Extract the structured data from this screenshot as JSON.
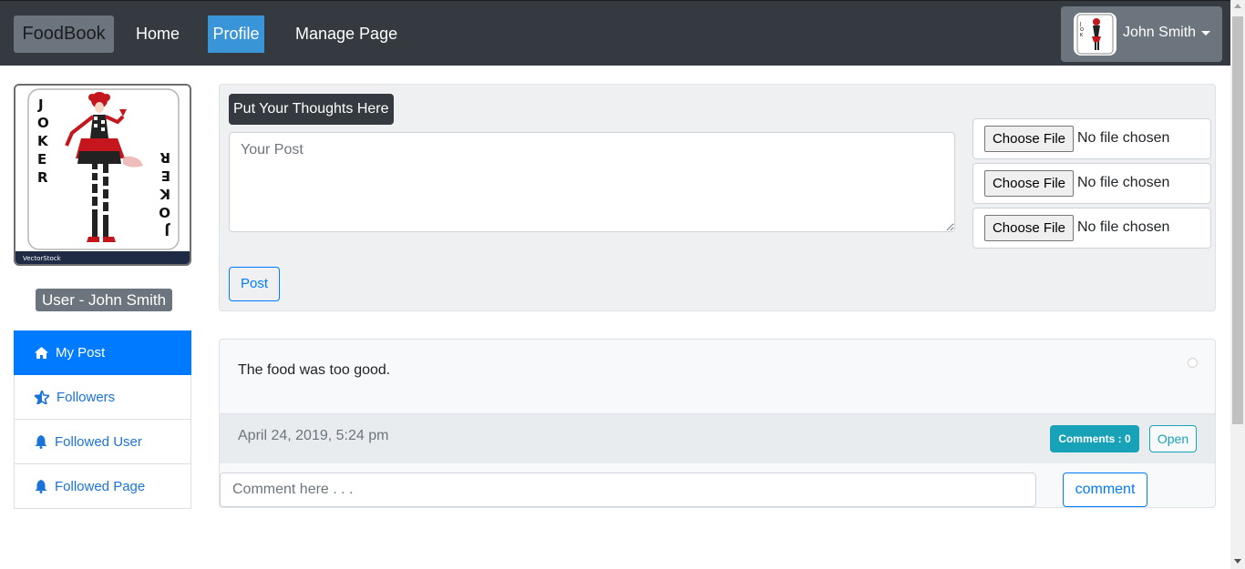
{
  "navbar": {
    "brand": "FoodBook",
    "links": [
      {
        "label": "Home",
        "active": false
      },
      {
        "label": "Profile",
        "active": true
      },
      {
        "label": "Manage Page",
        "active": false
      }
    ],
    "user": {
      "name": "John Smith",
      "avatar_icon": "joker-card-avatar"
    }
  },
  "sidebar": {
    "profile_image": {
      "icon": "joker-card-image",
      "card_letters_left": "JOKER",
      "card_letters_right": "JOKER",
      "watermark": "VectorStock"
    },
    "user_badge": "User - John Smith",
    "items": [
      {
        "label": "My Post",
        "icon": "home-icon",
        "active": true
      },
      {
        "label": "Followers",
        "icon": "star-half-icon",
        "active": false
      },
      {
        "label": "Followed User",
        "icon": "bell-icon",
        "active": false
      },
      {
        "label": "Followed Page",
        "icon": "bell-icon",
        "active": false
      }
    ]
  },
  "composer": {
    "label": "Put Your Thoughts Here",
    "textarea_placeholder": "Your Post",
    "files": [
      {
        "button": "Choose File",
        "status": "No file chosen"
      },
      {
        "button": "Choose File",
        "status": "No file chosen"
      },
      {
        "button": "Choose File",
        "status": "No file chosen"
      }
    ],
    "post_button": "Post"
  },
  "posts": [
    {
      "text": "The food was too good.",
      "date": "April 24, 2019, 5:24 pm",
      "comments_badge": "Comments : 0",
      "open_button": "Open",
      "comment_placeholder": "Comment here . . .",
      "comment_button": "comment"
    }
  ],
  "colors": {
    "navbar_bg": "#343a40",
    "primary": "#007bff",
    "info": "#17a2b8",
    "secondary": "#6c757d"
  }
}
